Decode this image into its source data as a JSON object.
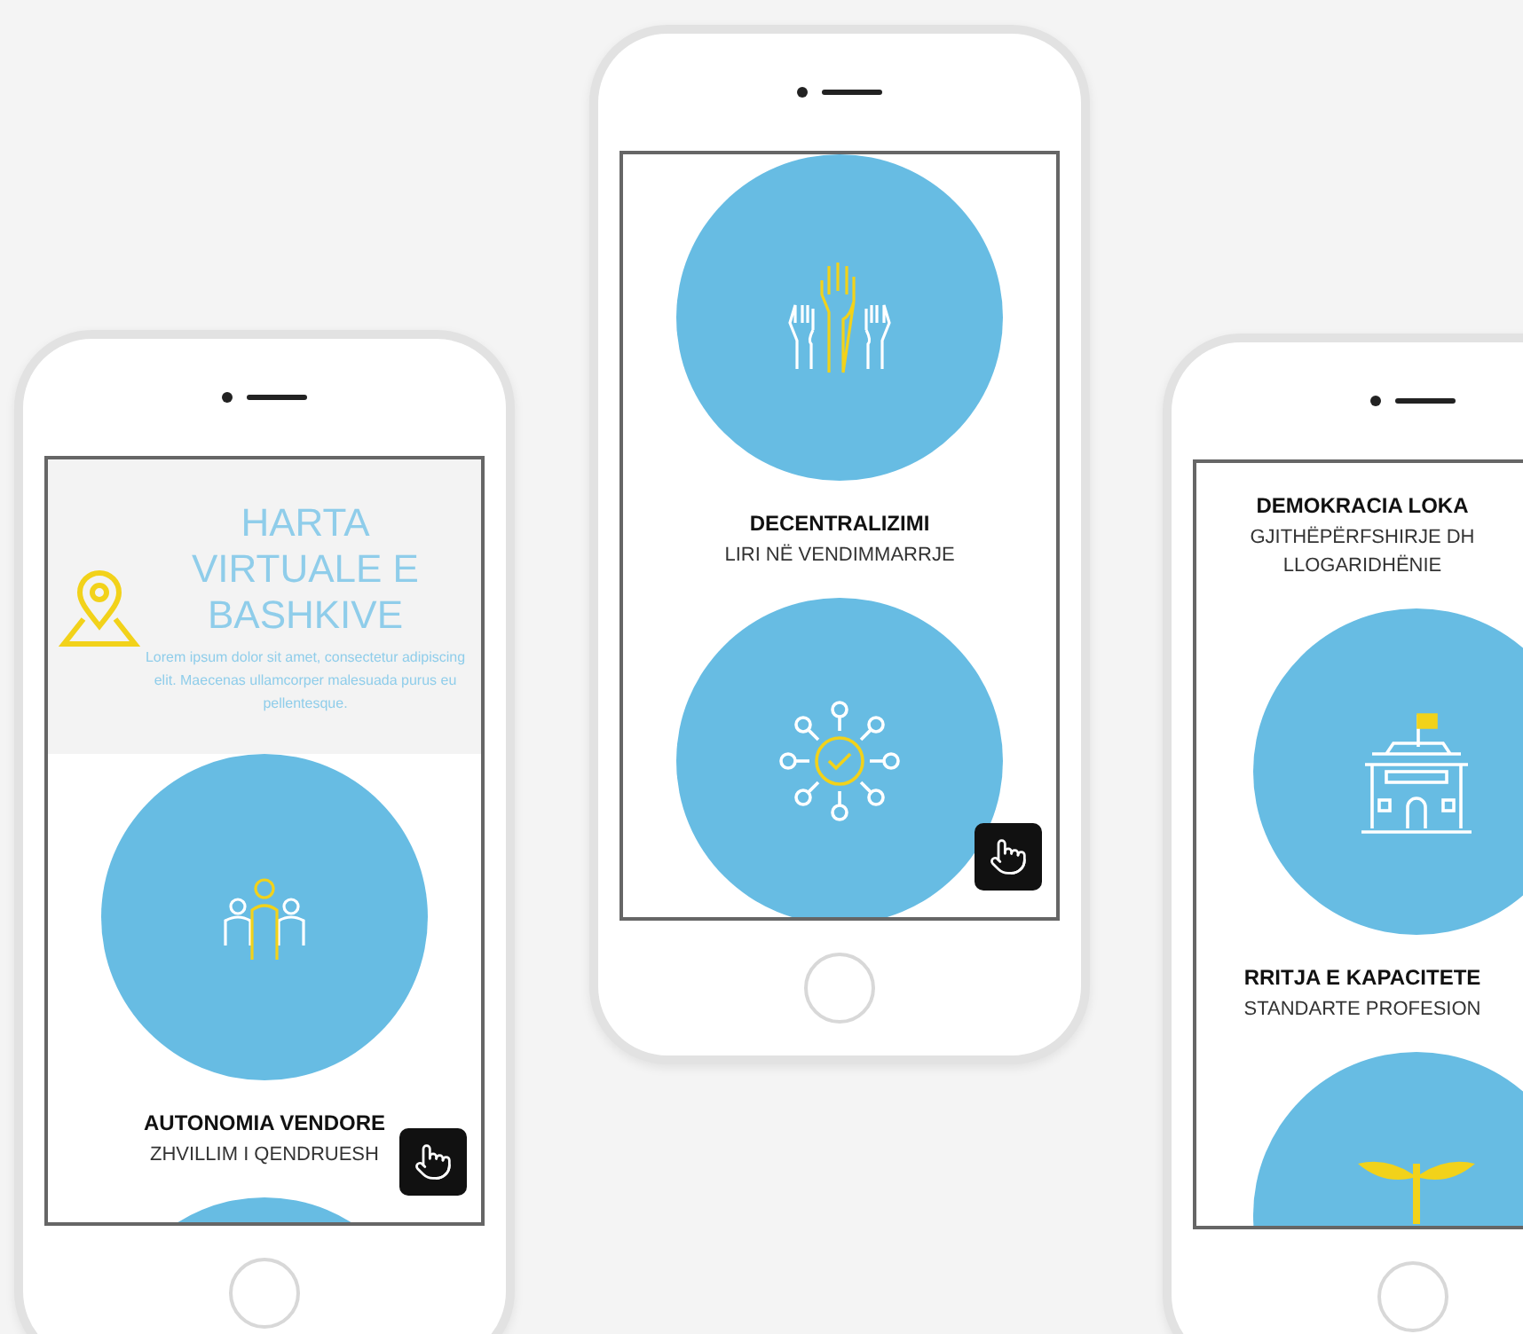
{
  "phones": [
    {
      "screen": [
        {
          "kind": "banner",
          "title": "HARTA VIRTUALE E BASHKIVE",
          "body": "Lorem ipsum dolor sit amet, consectetur adipiscing elit. Maecenas ullamcorper malesuada purus eu pellentesque."
        },
        {
          "kind": "people"
        },
        {
          "kind": "caption",
          "lines": [
            "AUTONOMIA VENDORE",
            "ZHVILLIM I QENDRUESH"
          ]
        },
        {
          "kind": "disc"
        },
        {
          "kind": "touch"
        }
      ]
    },
    {
      "screen": [
        {
          "kind": "hands"
        },
        {
          "kind": "caption",
          "lines": [
            "DECENTRALIZIMI",
            "LIRI NË VENDIMMARRJE"
          ]
        },
        {
          "kind": "network"
        },
        {
          "kind": "touch"
        }
      ]
    },
    {
      "screen": [
        {
          "kind": "caption",
          "lines": [
            "DEMOKRACIA LOKA",
            "GJITHËPËRFSHIRJE DH",
            "LLOGARIDHËNIE"
          ]
        },
        {
          "kind": "building"
        },
        {
          "kind": "caption",
          "lines": [
            "RRITJA E KAPACITETE",
            "STANDARTE PROFESION"
          ]
        },
        {
          "kind": "plant"
        }
      ]
    }
  ]
}
